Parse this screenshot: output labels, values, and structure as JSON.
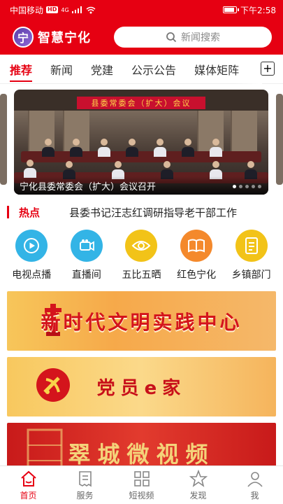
{
  "status_bar": {
    "carrier": "中国移动",
    "hd": "HD",
    "network": "4G",
    "time": "下午2:58",
    "battery_level": 0.8
  },
  "header": {
    "app_name": "智慧宁化",
    "logo_char": "宁",
    "search_placeholder": "新闻搜索",
    "brand_color": "#e60012"
  },
  "tabs": [
    {
      "label": "推荐",
      "active": true
    },
    {
      "label": "新闻",
      "active": false
    },
    {
      "label": "党建",
      "active": false
    },
    {
      "label": "公示公告",
      "active": false
    },
    {
      "label": "媒体矩阵",
      "active": false
    }
  ],
  "carousel": {
    "banner_text": "县委常委会（扩大）会议",
    "caption": "宁化县委常委会（扩大）会议召开",
    "slide_count": 5,
    "active_index": 0
  },
  "hot": {
    "label": "热点",
    "headline": "县委书记汪志红调研指导老干部工作"
  },
  "quick_links": [
    {
      "label": "电视点播",
      "icon": "tv-play-icon",
      "color": "#33b4e6"
    },
    {
      "label": "直播间",
      "icon": "camera-icon",
      "color": "#33b4e6"
    },
    {
      "label": "五比五晒",
      "icon": "eye-icon",
      "color": "#f2c318"
    },
    {
      "label": "红色宁化",
      "icon": "book-icon",
      "color": "#f4892c"
    },
    {
      "label": "乡镇部门",
      "icon": "document-icon",
      "color": "#f2c318"
    }
  ],
  "promos": [
    {
      "text": "新时代文明实践中心"
    },
    {
      "text": "党员e家"
    },
    {
      "text": "翠城微视频"
    }
  ],
  "bottom_nav": [
    {
      "label": "首页",
      "icon": "home-icon",
      "active": true
    },
    {
      "label": "服务",
      "icon": "receipt-icon",
      "active": false
    },
    {
      "label": "短视频",
      "icon": "grid-icon",
      "active": false
    },
    {
      "label": "发现",
      "icon": "star-icon",
      "active": false
    },
    {
      "label": "我",
      "icon": "user-icon",
      "active": false
    }
  ]
}
